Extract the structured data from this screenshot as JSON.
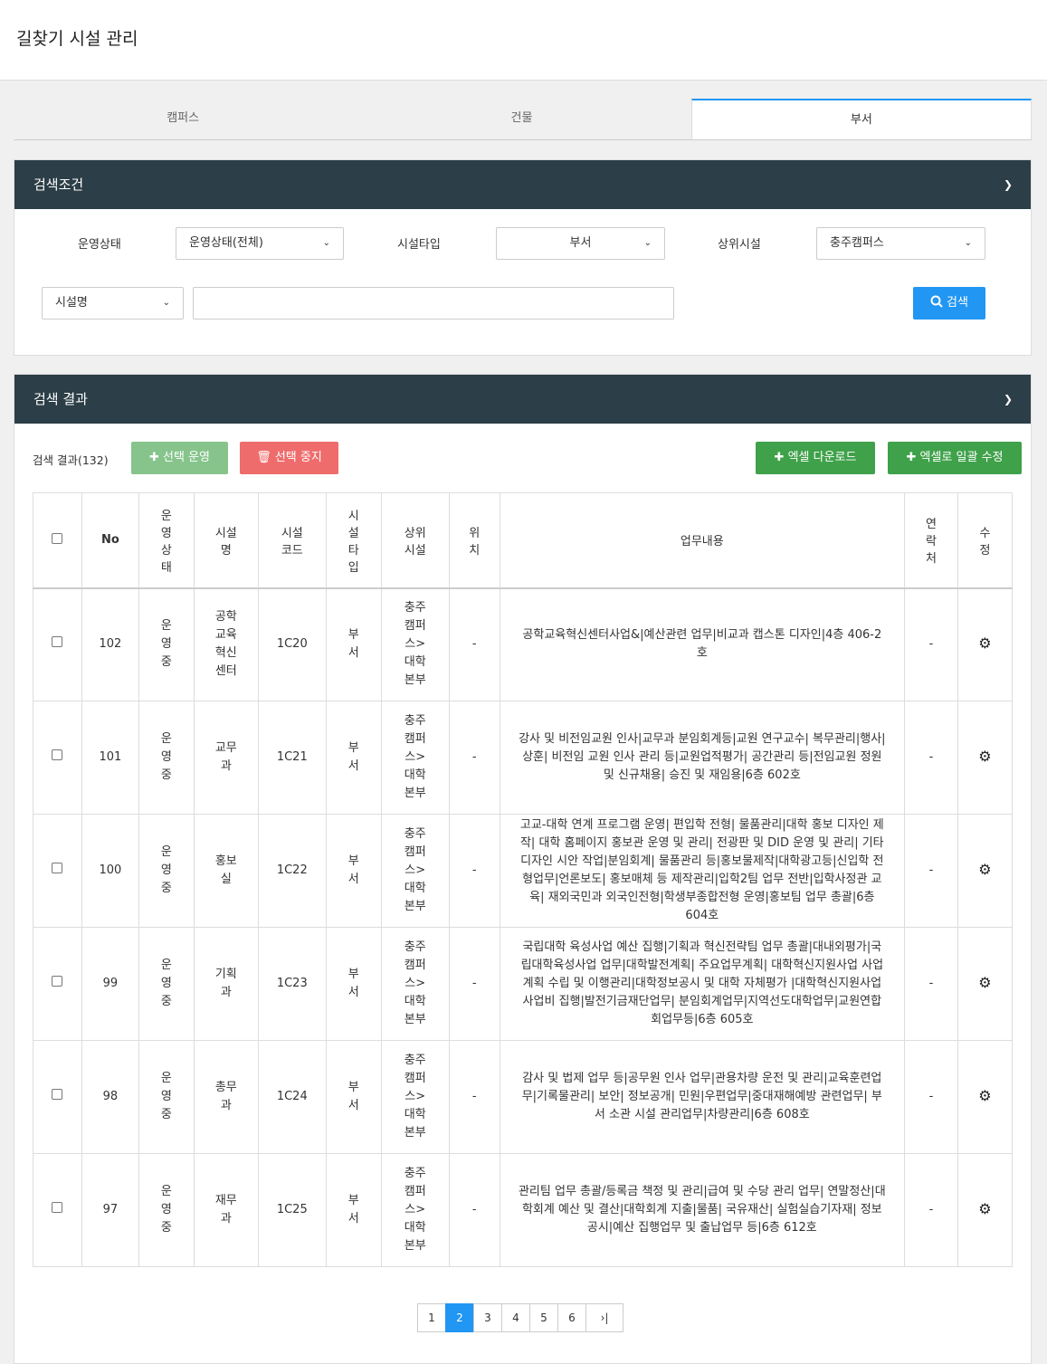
{
  "page_title": "길찾기 시설 관리",
  "tabs": [
    {
      "label": "캠퍼스"
    },
    {
      "label": "건물"
    },
    {
      "label": "부서"
    }
  ],
  "search": {
    "title": "검색조건",
    "status_label": "운영상태",
    "status_value": "운영상태(전체)",
    "type_label": "시설타입",
    "type_value": "부서",
    "parent_label": "상위시설",
    "parent_value": "충주캠퍼스",
    "field_value": "시설명",
    "keyword_value": "",
    "search_button": "검색"
  },
  "results": {
    "title": "검색 결과",
    "count_text": "검색 결과(132)",
    "btn_select_run": "선택 운영",
    "btn_select_stop": "선택 중지",
    "btn_excel_download": "엑셀 다운로드",
    "btn_excel_bulk": "엑셀로 일괄 수정",
    "headers": [
      "",
      "No",
      "운영상태",
      "시설명",
      "시설코드",
      "시설타입",
      "상위시설",
      "위치",
      "업무내용",
      "연락처",
      "수정"
    ],
    "rows": [
      {
        "no": "102",
        "status": "운영중",
        "name": "공학교육혁신센터",
        "code": "1C20",
        "type": "부서",
        "parent": "충주캠퍼스>대학본부",
        "location": "-",
        "work": "공학교육혁신센터사업&|예산관련 업무|비교과 캡스톤 디자인|4층 406-2호",
        "contact": "-"
      },
      {
        "no": "101",
        "status": "운영중",
        "name": "교무과",
        "code": "1C21",
        "type": "부서",
        "parent": "충주캠퍼스>대학본부",
        "location": "-",
        "work": "강사 및 비전임교원 인사|교무과 분임회계등|교원 연구교수| 복무관리|행사| 상훈| 비전임 교원 인사 관리 등|교원업적평가| 공간관리 등|전임교원 정원 및 신규채용| 승진 및 재임용|6층 602호",
        "contact": "-"
      },
      {
        "no": "100",
        "status": "운영중",
        "name": "홍보실",
        "code": "1C22",
        "type": "부서",
        "parent": "충주캠퍼스>대학본부",
        "location": "-",
        "work": "고교-대학 연계 프로그램 운영| 편입학 전형| 물품관리|대학 홍보 디자인 제작| 대학 홈페이지 홍보관 운영 및 관리| 전광판 및 DID 운영 및 관리| 기타 디자인 시안 작업|분임회계| 물품관리 등|홍보물제작|대학광고등|신입학 전형업무|언론보도| 홍보매체 등 제작관리|입학2팀 업무 전반|입학사정관 교육| 재외국민과 외국인전형|학생부종합전형 운영|홍보팀 업무 총괄|6층 604호",
        "contact": "-"
      },
      {
        "no": "99",
        "status": "운영중",
        "name": "기획과",
        "code": "1C23",
        "type": "부서",
        "parent": "충주캠퍼스>대학본부",
        "location": "-",
        "work": "국립대학 육성사업 예산 집행|기획과 혁신전략팀 업무 총괄|대내외평가|국립대학육성사업 업무|대학발전계획| 주요업무계획| 대학혁신지원사업 사업계획 수립 및 이행관리|대학정보공시 및 대학 자체평가 |대학혁신지원사업 사업비 집행|발전기금재단업무| 분임회계업무|지역선도대학업무|교원연합회업무등|6층 605호",
        "contact": "-"
      },
      {
        "no": "98",
        "status": "운영중",
        "name": "총무과",
        "code": "1C24",
        "type": "부서",
        "parent": "충주캠퍼스>대학본부",
        "location": "-",
        "work": "감사 및 법제 업무 등|공무원 인사 업무|관용차량 운전 및 관리|교육훈련업무|기록물관리| 보안| 정보공개| 민원|우편업무|중대재해예방 관련업무| 부서 소관 시설 관리업무|차량관리|6층 608호",
        "contact": "-"
      },
      {
        "no": "97",
        "status": "운영중",
        "name": "재무과",
        "code": "1C25",
        "type": "부서",
        "parent": "충주캠퍼스>대학본부",
        "location": "-",
        "work": "관리팀 업무 총괄/등록금 책정 및 관리|급여 및 수당 관리 업무| 연말정산|대학회계 예산 및 결산|대학회계 지출|물품| 국유재산| 실험실습기자재| 정보공시|예산 집행업무 및 출납업무 등|6층 612호",
        "contact": "-"
      }
    ]
  },
  "pagination": {
    "pages": [
      "1",
      "2",
      "3",
      "4",
      "5",
      "6"
    ],
    "current": "2",
    "last_label": "›|"
  },
  "colors": {
    "header_bg": "#2c3e47",
    "accent_blue": "#2196f3",
    "green": "#3fa14a",
    "red": "#ef6c6c"
  }
}
